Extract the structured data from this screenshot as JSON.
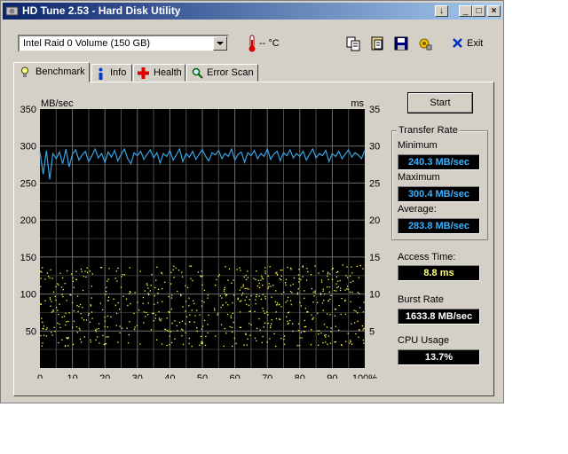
{
  "window": {
    "title": "HD Tune 2.53 - Hard Disk Utility",
    "caption_buttons": [
      "↓",
      "_",
      "□",
      "×"
    ]
  },
  "toolbar": {
    "drive": "Intel  Raid 0 Volume (150 GB)",
    "temperature": "-- °C",
    "exit_label": "Exit",
    "icons": [
      "copy-icon",
      "copy-info-icon",
      "save-icon",
      "options-icon"
    ]
  },
  "tabs": [
    {
      "label": "Benchmark",
      "icon": "lightbulb-icon",
      "active": true
    },
    {
      "label": "Info",
      "icon": "info-icon",
      "active": false
    },
    {
      "label": "Health",
      "icon": "health-cross-icon",
      "active": false
    },
    {
      "label": "Error Scan",
      "icon": "magnifier-icon",
      "active": false
    }
  ],
  "benchmark": {
    "start_label": "Start",
    "transfer_rate_title": "Transfer Rate",
    "minimum_label": "Minimum",
    "minimum_value": "240.3 MB/sec",
    "maximum_label": "Maximum",
    "maximum_value": "300.4 MB/sec",
    "average_label": "Average:",
    "average_value": "283.8 MB/sec",
    "access_time_label": "Access Time:",
    "access_time_value": "8.8 ms",
    "burst_rate_label": "Burst Rate",
    "burst_rate_value": "1633.8 MB/sec",
    "cpu_usage_label": "CPU Usage",
    "cpu_usage_value": "13.7%",
    "colors": {
      "transfer": "#37a4e6",
      "access": "#ffff50",
      "value_text_blue": "#3ab0ff",
      "value_text_yellow": "#ffff80"
    }
  },
  "chart_data": {
    "type": "line",
    "ylabel_left": "MB/sec",
    "ylabel_right": "ms",
    "xlim": [
      0,
      100
    ],
    "ylim_left": [
      0,
      350
    ],
    "ylim_right": [
      0,
      35
    ],
    "x_ticks": [
      "0",
      "10",
      "20",
      "30",
      "40",
      "50",
      "60",
      "70",
      "80",
      "90",
      "100%"
    ],
    "y_ticks_left": [
      "350",
      "300",
      "250",
      "200",
      "150",
      "100",
      "50"
    ],
    "y_ticks_right": [
      "35",
      "30",
      "25",
      "20",
      "15",
      "10",
      "5"
    ],
    "grid": true,
    "series": [
      {
        "kind": "transfer-rate",
        "axis": "left",
        "x": [
          0,
          1,
          2,
          3,
          4,
          5,
          6,
          7,
          8,
          9,
          10,
          11,
          12,
          13,
          14,
          15,
          16,
          17,
          18,
          19,
          20,
          21,
          22,
          23,
          24,
          25,
          26,
          27,
          28,
          29,
          30,
          31,
          32,
          33,
          34,
          35,
          36,
          37,
          38,
          39,
          40,
          41,
          42,
          43,
          44,
          45,
          46,
          47,
          48,
          49,
          50,
          51,
          52,
          53,
          54,
          55,
          56,
          57,
          58,
          59,
          60,
          61,
          62,
          63,
          64,
          65,
          66,
          67,
          68,
          69,
          70,
          71,
          72,
          73,
          74,
          75,
          76,
          77,
          78,
          79,
          80,
          81,
          82,
          83,
          84,
          85,
          86,
          87,
          88,
          89,
          90,
          91,
          92,
          93,
          94,
          95,
          96,
          97,
          98,
          99,
          100
        ],
        "y": [
          292,
          262,
          294,
          255,
          290,
          283,
          292,
          276,
          296,
          272,
          289,
          295,
          281,
          288,
          293,
          279,
          287,
          296,
          284,
          290,
          278,
          292,
          285,
          294,
          280,
          289,
          296,
          283,
          276,
          291,
          287,
          293,
          282,
          289,
          295,
          284,
          291,
          277,
          290,
          286,
          294,
          281,
          288,
          296,
          279,
          290,
          285,
          293,
          282,
          289,
          295,
          286,
          280,
          291,
          288,
          294,
          283,
          290,
          286,
          296,
          281,
          289,
          292,
          278,
          291,
          287,
          294,
          283,
          290,
          286,
          296,
          282,
          289,
          293,
          280,
          291,
          287,
          295,
          284,
          290,
          286,
          293,
          281,
          289,
          296,
          284,
          290,
          287,
          294,
          279,
          290,
          286,
          293,
          283,
          289,
          295,
          285,
          291,
          288,
          283,
          294
        ]
      },
      {
        "kind": "access-time",
        "axis": "right",
        "style": "scatter",
        "range": [
          3,
          14
        ]
      }
    ]
  }
}
